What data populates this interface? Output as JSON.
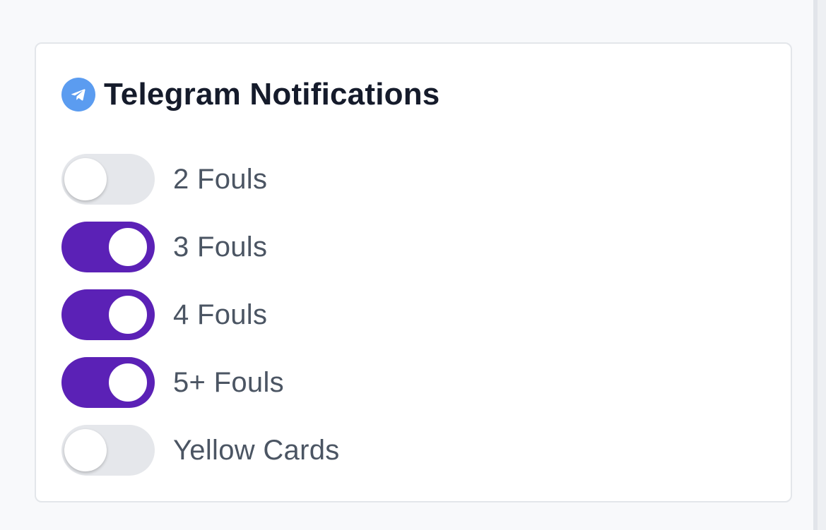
{
  "card": {
    "title": "Telegram Notifications",
    "icon": "telegram-icon",
    "icon_color": "#5b9cf0"
  },
  "toggles": [
    {
      "label": "2 Fouls",
      "checked": false
    },
    {
      "label": "3 Fouls",
      "checked": true
    },
    {
      "label": "4 Fouls",
      "checked": true
    },
    {
      "label": "5+ Fouls",
      "checked": true
    },
    {
      "label": "Yellow Cards",
      "checked": false
    }
  ],
  "colors": {
    "toggle_on": "#5b21b6",
    "toggle_off": "#e5e7eb",
    "title_text": "#151b2b",
    "label_text": "#4b5563",
    "page_background": "#f8f9fb",
    "card_border": "#e3e6ea"
  }
}
